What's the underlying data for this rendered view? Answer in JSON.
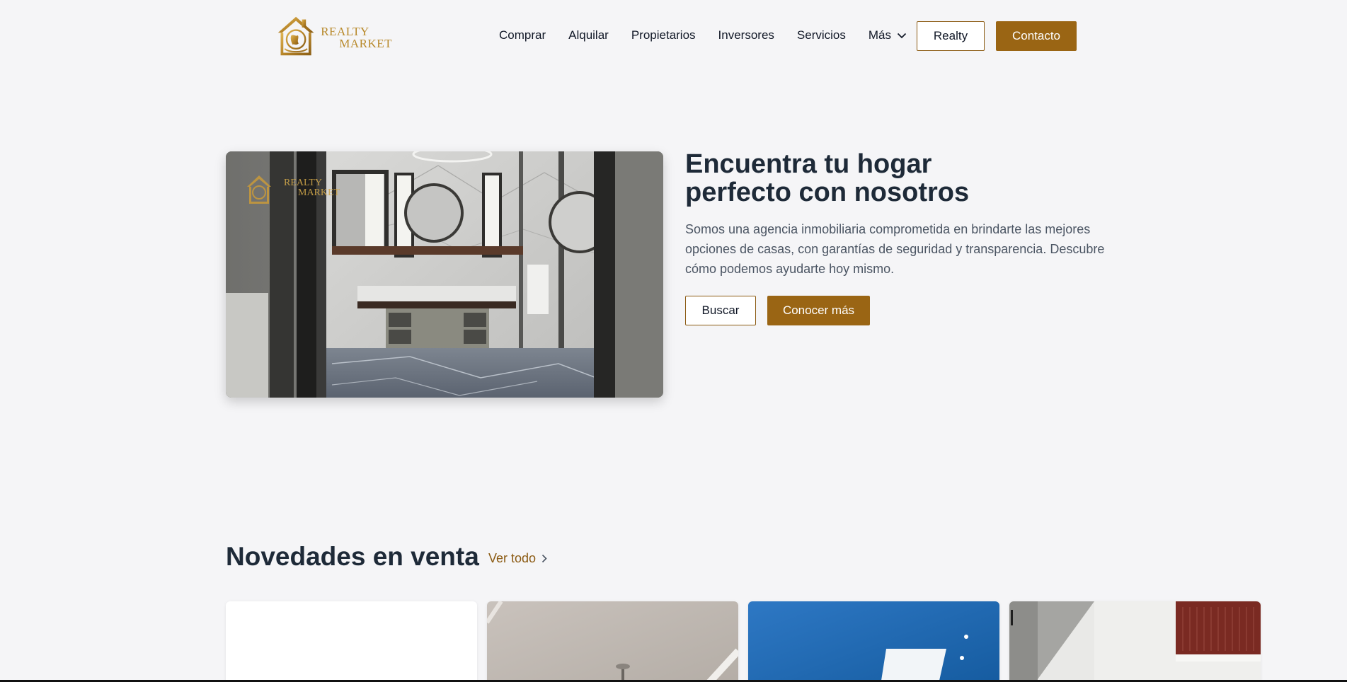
{
  "brand": {
    "logo_line1": "REALTY",
    "logo_line2": "MARKET",
    "gold": "#b8892a",
    "accent": "#9a6514"
  },
  "nav": {
    "items": [
      "Comprar",
      "Alquilar",
      "Propietarios",
      "Inversores",
      "Servicios"
    ],
    "more_label": "Más",
    "realty_button": "Realty",
    "contact_button": "Contacto"
  },
  "hero": {
    "title": "Encuentra tu hogar perfecto con nosotros",
    "description": "Somos una agencia inmobiliaria comprometida en brindarte las mejores opciones de casas, con garantías de seguridad y transparencia. Descubre cómo podemos ayudarte hoy mismo.",
    "search_button": "Buscar",
    "learn_more_button": "Conocer más",
    "image_logo_line1": "REALTY",
    "image_logo_line2": "MARKET"
  },
  "listings": {
    "title": "Novedades en venta",
    "see_all": "Ver todo",
    "cards": [
      {
        "image": "blank-white"
      },
      {
        "image": "white-ceiling-interior"
      },
      {
        "image": "blue-ceiling-interior"
      },
      {
        "image": "white-building-exterior"
      }
    ]
  }
}
